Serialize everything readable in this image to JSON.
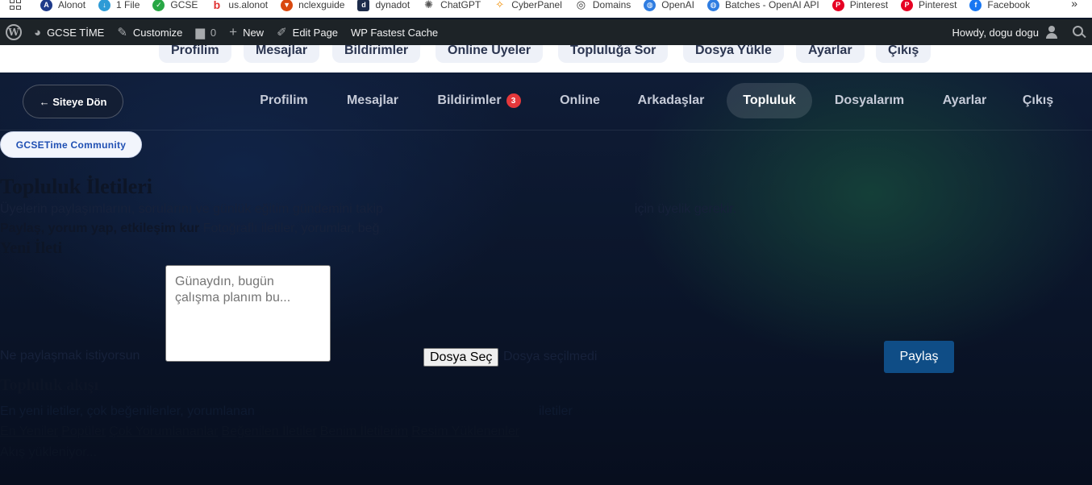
{
  "bookmarks": {
    "items": [
      {
        "label": "Alonot",
        "color": "#1e3a8a"
      },
      {
        "label": "1 File",
        "color": "#2e9bd6"
      },
      {
        "label": "GCSE",
        "color": "#28a745"
      },
      {
        "label": "us.alonot",
        "color": "#e03131"
      },
      {
        "label": "nclexguide",
        "color": "#d9480f"
      },
      {
        "label": "dynadot",
        "color": "#1c2b4a"
      },
      {
        "label": "ChatGPT",
        "color": "#555555"
      },
      {
        "label": "CyberPanel",
        "color": "#f08c00"
      },
      {
        "label": "Domains",
        "color": "#333333"
      },
      {
        "label": "OpenAI",
        "color": "#2f7de1"
      },
      {
        "label": "Batches - OpenAI API",
        "color": "#2f7de1"
      },
      {
        "label": "Pinterest",
        "color": "#e60023"
      },
      {
        "label": "Pinterest",
        "color": "#e60023"
      },
      {
        "label": "Facebook",
        "color": "#1877f2"
      }
    ],
    "more": "»"
  },
  "adminbar": {
    "site": "GCSE TİME",
    "customize": "Customize",
    "comments": "0",
    "new": "New",
    "edit": "Edit Page",
    "cache": "WP Fastest Cache",
    "howdy": "Howdy, dogu dogu"
  },
  "strip": [
    "Profilim",
    "Mesajlar",
    "Bildirimler",
    "Online Üyeler",
    "Topluluğa Sor",
    "Dosya Yükle",
    "Ayarlar",
    "Çıkış"
  ],
  "nav": {
    "back": "← Siteye Dön",
    "items": [
      "Profilim",
      "Mesajlar",
      "Bildirimler",
      "Online",
      "Arkadaşlar",
      "Topluluk",
      "Dosyalarım",
      "Ayarlar",
      "Çıkış"
    ],
    "active": "Topluluk",
    "notif_count": "3"
  },
  "community_label": "GCSETime Community",
  "title": "Topluluk İletileri",
  "description": "Üyelerin paylaşımlarını, sorularını ve günlük eğitim gündemini takip",
  "description_tail": "için üyelik gerekir.",
  "sub_bold": "Paylaş, yorum yap, etkileşim kur",
  "sub_text": "Fotoğraflı iletiler, yorumlar, beğ",
  "new_post": "Yeni İleti",
  "ask_label": "Ne paylaşmak istiyorsun",
  "textarea_placeholder": "Günaydın, bugün çalışma planım bu...",
  "file_button": "Dosya Seç",
  "file_none": "Dosya seçilmedi",
  "share": "Paylaş",
  "feed_title": "Topluluk akışı",
  "feed_desc": "En yeni iletiler, çok beğenilenler, yorumlanan",
  "feed_tail": "iletiler",
  "filters": [
    "En Yeniler",
    "Popüler",
    "Çok Yorumlananlar",
    "Beğenilen İletiler",
    "Benim İletilerim",
    "Resim Yüklenenler"
  ],
  "loading": "Akış yükleniyor..."
}
